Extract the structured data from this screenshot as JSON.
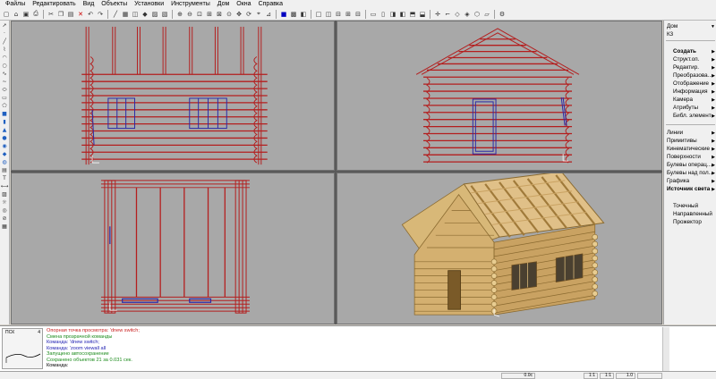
{
  "menu": [
    "Файлы",
    "Редактировать",
    "Вид",
    "Объекты",
    "Установки",
    "Инструменты",
    "Дом",
    "Окна",
    "Справка"
  ],
  "right_panel": {
    "top": [
      "Дом",
      "К3"
    ],
    "group1": [
      {
        "label": "Создать",
        "bold": true,
        "arrow": true
      },
      {
        "label": "Структ.оп.",
        "arrow": true
      },
      {
        "label": "Редактир.",
        "arrow": true
      },
      {
        "label": "Преобразова...",
        "arrow": true
      },
      {
        "label": "Отображение",
        "arrow": true
      },
      {
        "label": "Информация",
        "arrow": true
      },
      {
        "label": "Камера",
        "arrow": true
      },
      {
        "label": "Атрибуты",
        "arrow": true
      },
      {
        "label": "Библ. элемент",
        "arrow": true
      }
    ],
    "group2": [
      {
        "label": "Линии",
        "arrow": true
      },
      {
        "label": "Примитивы",
        "arrow": true
      },
      {
        "label": "Кинематические",
        "arrow": true
      },
      {
        "label": "Поверхности",
        "arrow": true
      },
      {
        "label": "Булевы операц...",
        "arrow": true
      },
      {
        "label": "Булевы над пол...",
        "arrow": true
      },
      {
        "label": "Графика",
        "arrow": true
      },
      {
        "label": "Источник света",
        "bold": true,
        "arrow": true
      }
    ],
    "group3": [
      "Точечный",
      "Направленный",
      "Прожектор"
    ]
  },
  "lcs": {
    "label": "ПСК",
    "number": "4"
  },
  "console": [
    {
      "text": "Опорная точка просмотра: 'dnew switch;",
      "color": "red"
    },
    {
      "text": "Смена прозрачной команды",
      "color": "green"
    },
    {
      "text": "Команда: 'dnew switch;",
      "color": "blue"
    },
    {
      "text": "Команда: 'zoom viewall all",
      "color": "blue"
    },
    {
      "text": "Запущено автосохранение",
      "color": "green"
    },
    {
      "text": "Сохранено объектов 21 за 0.031 сек.",
      "color": "green"
    },
    {
      "text": "Команда:",
      "color": "black"
    }
  ],
  "status": {
    "angle": "0.0с",
    "scale1": "1:1",
    "scale2": "1:1",
    "zoom": "1.0"
  },
  "colors": {
    "wire_red": "#b41e1e",
    "wire_blue": "#2a2aa8",
    "viewport_bg": "#a8a8a8",
    "wood": "#d8b878",
    "wood_dark": "#8a6a30"
  }
}
